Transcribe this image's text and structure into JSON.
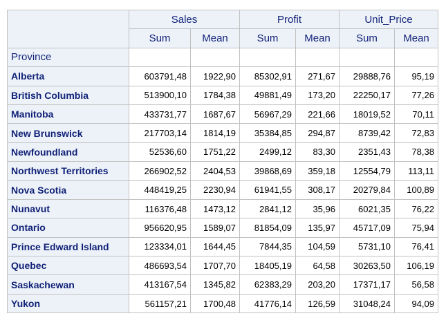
{
  "table": {
    "groups": [
      "Sales",
      "Profit",
      "Unit_Price"
    ],
    "stats": [
      "Sum",
      "Mean",
      "Sum",
      "Mean",
      "Sum",
      "Mean"
    ],
    "row_header": "Province",
    "rows": [
      {
        "label": "Alberta",
        "values": [
          "603791,48",
          "1922,90",
          "85302,91",
          "271,67",
          "29888,76",
          "95,19"
        ]
      },
      {
        "label": "British Columbia",
        "values": [
          "513900,10",
          "1784,38",
          "49881,49",
          "173,20",
          "22250,17",
          "77,26"
        ]
      },
      {
        "label": "Manitoba",
        "values": [
          "433731,77",
          "1687,67",
          "56967,29",
          "221,66",
          "18019,52",
          "70,11"
        ]
      },
      {
        "label": "New Brunswick",
        "values": [
          "217703,14",
          "1814,19",
          "35384,85",
          "294,87",
          "8739,42",
          "72,83"
        ]
      },
      {
        "label": "Newfoundland",
        "values": [
          "52536,60",
          "1751,22",
          "2499,12",
          "83,30",
          "2351,43",
          "78,38"
        ]
      },
      {
        "label": "Northwest Territories",
        "values": [
          "266902,52",
          "2404,53",
          "39868,69",
          "359,18",
          "12554,79",
          "113,11"
        ]
      },
      {
        "label": "Nova Scotia",
        "values": [
          "448419,25",
          "2230,94",
          "61941,55",
          "308,17",
          "20279,84",
          "100,89"
        ]
      },
      {
        "label": "Nunavut",
        "values": [
          "116376,48",
          "1473,12",
          "2841,12",
          "35,96",
          "6021,35",
          "76,22"
        ]
      },
      {
        "label": "Ontario",
        "values": [
          "956620,95",
          "1589,07",
          "81854,09",
          "135,97",
          "45717,09",
          "75,94"
        ]
      },
      {
        "label": "Prince Edward Island",
        "values": [
          "123334,01",
          "1644,45",
          "7844,35",
          "104,59",
          "5731,10",
          "76,41"
        ]
      },
      {
        "label": "Quebec",
        "values": [
          "486693,54",
          "1707,70",
          "18405,19",
          "64,58",
          "30263,50",
          "106,19"
        ]
      },
      {
        "label": "Saskachewan",
        "values": [
          "413167,54",
          "1345,82",
          "62383,29",
          "203,20",
          "17371,17",
          "56,58"
        ]
      },
      {
        "label": "Yukon",
        "values": [
          "561157,21",
          "1700,48",
          "41776,14",
          "126,59",
          "31048,24",
          "94,09"
        ]
      }
    ]
  }
}
